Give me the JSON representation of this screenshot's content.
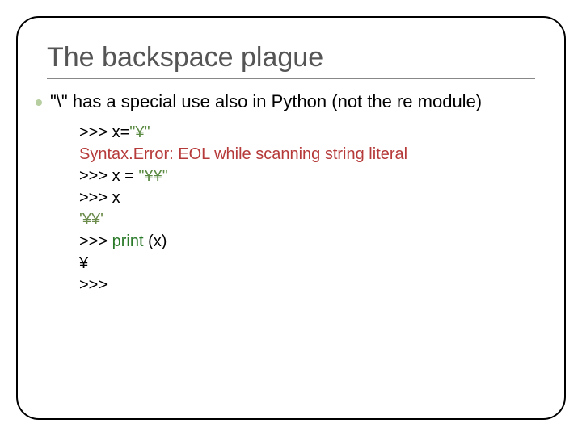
{
  "title": "The backspace plague",
  "body": "\"\\\" has a special use also in Python (not the re module)",
  "code": {
    "l1_prompt": ">>> ",
    "l1_code_a": "x=",
    "l1_code_b": "\"¥\"",
    "l2_error": "Syntax.Error: EOL while scanning string literal",
    "l3_prompt": ">>> ",
    "l3_code_a": "x = ",
    "l3_code_b": "\"¥¥\"",
    "l4_prompt": ">>> ",
    "l4_code": "x",
    "l5_out": "'¥¥'",
    "l6_prompt": ">>> ",
    "l6_func": "print ",
    "l6_args": "(x)",
    "l7_out": "¥",
    "l8_prompt": ">>>"
  }
}
